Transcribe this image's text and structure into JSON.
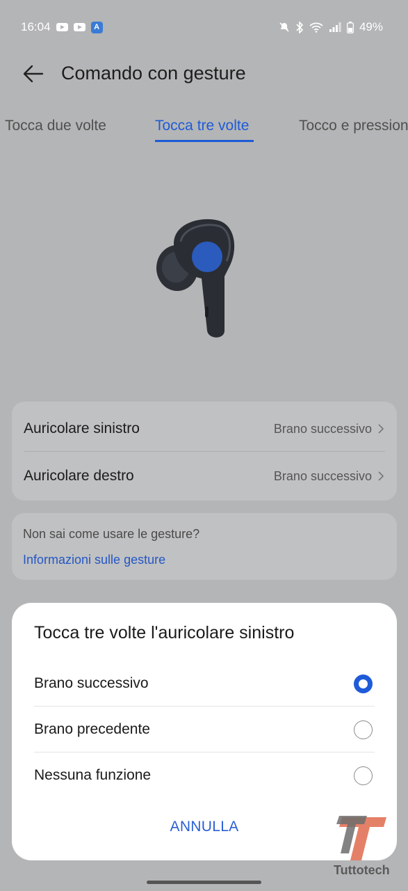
{
  "status_bar": {
    "time": "16:04",
    "battery": "49%",
    "icons": [
      "youtube-icon",
      "youtube-icon",
      "app-icon",
      "mute-icon",
      "bluetooth-icon",
      "wifi-icon",
      "signal-icon",
      "battery-icon"
    ]
  },
  "header": {
    "title": "Comando con gesture"
  },
  "tabs": [
    {
      "label": "Tocca due volte"
    },
    {
      "label": "Tocca tre volte"
    },
    {
      "label": "Tocco e pressione"
    }
  ],
  "settings": [
    {
      "label": "Auricolare sinistro",
      "value": "Brano successivo"
    },
    {
      "label": "Auricolare destro",
      "value": "Brano successivo"
    }
  ],
  "help": {
    "question": "Non sai come usare le gesture?",
    "link": "Informazioni sulle gesture"
  },
  "dialog": {
    "title": "Tocca tre volte l'auricolare sinistro",
    "options": [
      {
        "label": "Brano successivo",
        "selected": true
      },
      {
        "label": "Brano precedente",
        "selected": false
      },
      {
        "label": "Nessuna funzione",
        "selected": false
      }
    ],
    "cancel_label": "ANNULLA"
  },
  "watermark": {
    "text": "Tuttotech"
  },
  "colors": {
    "accent": "#1e5bd8",
    "dim_background": "#b4b5b6",
    "card": "#c0c1c2",
    "sheet": "#ffffff"
  }
}
